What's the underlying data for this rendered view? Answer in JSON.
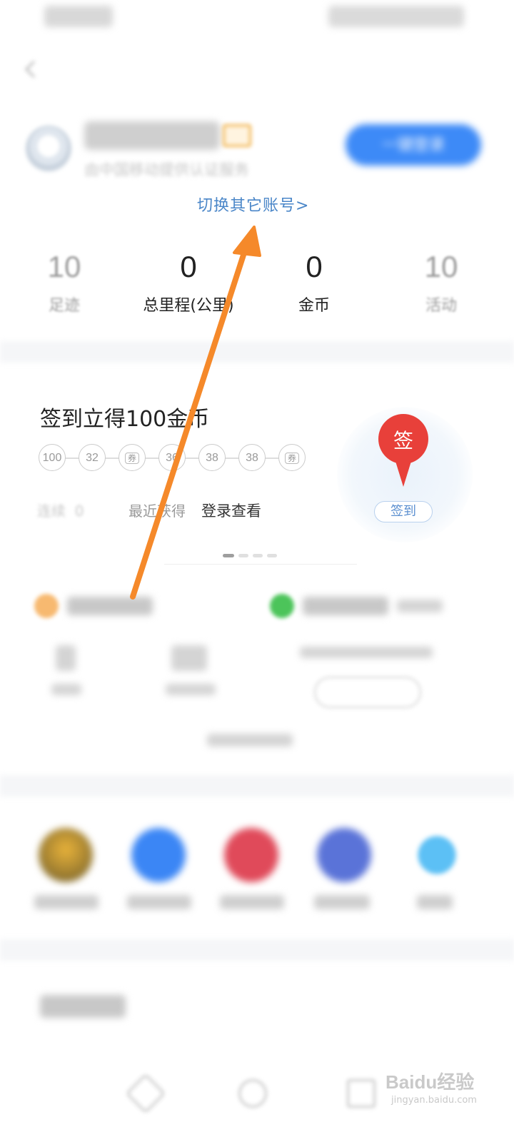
{
  "header": {
    "provider_text": "由中国移动提供认证服务",
    "login_button": "一键登录",
    "switch_account": "切换其它账号>"
  },
  "stats": [
    {
      "value": "10",
      "label": "足迹"
    },
    {
      "value": "0",
      "label": "总里程(公里)"
    },
    {
      "value": "0",
      "label": "金币"
    },
    {
      "value": "10",
      "label": "活动"
    }
  ],
  "signin_card": {
    "title": "签到立得100金币",
    "rewards": [
      "100",
      "32",
      "券",
      "36",
      "38",
      "38",
      "券"
    ],
    "streak_label": "连续",
    "streak_value": "0",
    "recent_label": "最近获得",
    "recent_value": "登录查看",
    "pin_text": "签",
    "button": "签到"
  },
  "watermark": {
    "brand": "Baidu经验",
    "url": "jingyan.baidu.com"
  },
  "colors": {
    "primary_blue": "#3d8af7",
    "link_blue": "#4a86c8",
    "pin_red": "#e8403a",
    "arrow_orange": "#f5892a"
  }
}
